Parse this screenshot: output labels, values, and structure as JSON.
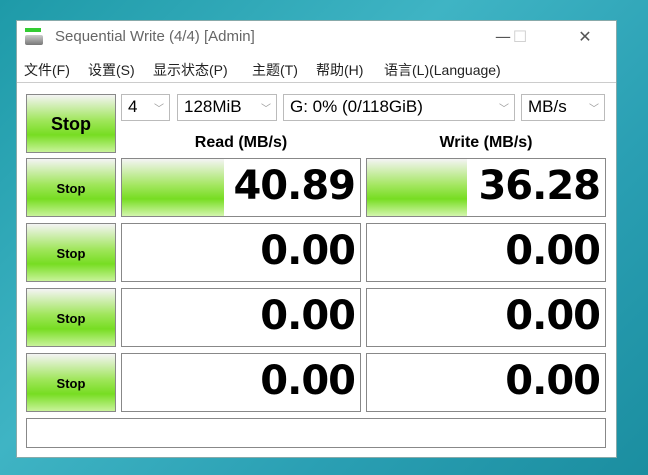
{
  "window": {
    "title": "Sequential Write (4/4) [Admin]",
    "minimize": "—",
    "maximize": "☐",
    "close": "✕"
  },
  "menu": [
    "文件(F)",
    "设置(S)",
    "显示状态(P)",
    "主题(T)",
    "帮助(H)",
    "语言(L)(Language)"
  ],
  "controls": {
    "all_button": "Stop",
    "count": "4",
    "size": "128MiB",
    "drive": "G: 0% (0/118GiB)",
    "unit": "MB/s",
    "chevron": "﹀"
  },
  "headers": {
    "read": "Read (MB/s)",
    "write": "Write (MB/s)"
  },
  "rows": [
    {
      "button": "Stop",
      "read": "40.89",
      "write": "36.28",
      "read_fill": 0.43,
      "write_fill": 0.42
    },
    {
      "button": "Stop",
      "read": "0.00",
      "write": "0.00",
      "read_fill": 0,
      "write_fill": 0
    },
    {
      "button": "Stop",
      "read": "0.00",
      "write": "0.00",
      "read_fill": 0,
      "write_fill": 0
    },
    {
      "button": "Stop",
      "read": "0.00",
      "write": "0.00",
      "read_fill": 0,
      "write_fill": 0
    }
  ]
}
